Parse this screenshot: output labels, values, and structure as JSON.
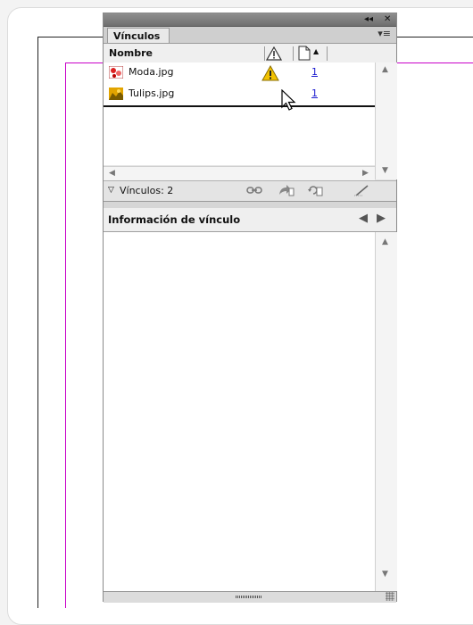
{
  "panel": {
    "title_buttons": {
      "collapse": "◂◂",
      "close": "✕"
    },
    "tab_label": "Vínculos",
    "menu_icon": "panel-menu-icon",
    "columns": {
      "name": "Nombre",
      "status_icon": "warning-icon",
      "page_icon": "page-icon"
    },
    "links": [
      {
        "name": "Moda.jpg",
        "page": "1",
        "status": "modified",
        "thumb_icon": "image-thumbnail-icon"
      },
      {
        "name": "Tulips.jpg",
        "page": "1",
        "status": "ok",
        "thumb_icon": "image-thumbnail-icon"
      }
    ],
    "status": {
      "count_label": "Vínculos: 2",
      "actions": [
        "relink-icon",
        "go-to-link-icon",
        "update-link-icon",
        "edit-original-icon"
      ]
    },
    "info": {
      "title": "Información de vínculo",
      "prev_icon": "previous-triangle-icon",
      "next_icon": "next-triangle-icon"
    }
  },
  "colors": {
    "guide": "#c800c8",
    "warning": "#f2c200",
    "link_page": "#1a1ad0"
  }
}
